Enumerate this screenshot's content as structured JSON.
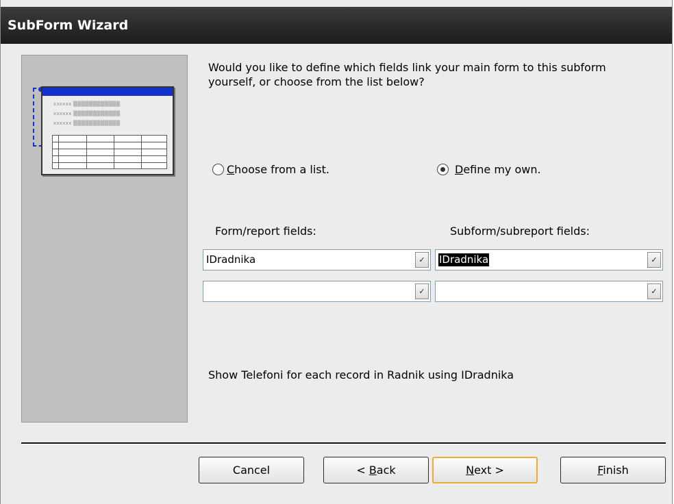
{
  "window": {
    "title": "SubForm Wizard"
  },
  "question": "Would you like to define which fields link your main form to this subform yourself, or choose from the list below?",
  "options": {
    "choose_from_list": {
      "label_prefix": "C",
      "label_rest": "hoose from a list.",
      "checked": false
    },
    "define_my_own": {
      "label_prefix": "D",
      "label_rest": "efine my own.",
      "checked": true
    }
  },
  "fields": {
    "form_label": "Form/report fields:",
    "subform_label": "Subform/subreport fields:",
    "form_values": [
      "IDradnika",
      ""
    ],
    "subform_values": [
      "IDradnika",
      ""
    ]
  },
  "summary": "Show Telefoni for each record in Radnik using IDradnika",
  "buttons": {
    "cancel": "Cancel",
    "back_prefix": "< ",
    "back_key": "B",
    "back_rest": "ack",
    "next_key": "N",
    "next_rest": "ext >",
    "finish_key": "F",
    "finish_rest": "inish"
  },
  "preview": {
    "placeholder_text": "xxxxxx ▒▒▒▒▒▒▒▒▒▒▒▒"
  },
  "colors": {
    "accent": "#1432c8",
    "default_button_border": "#f0a838"
  }
}
